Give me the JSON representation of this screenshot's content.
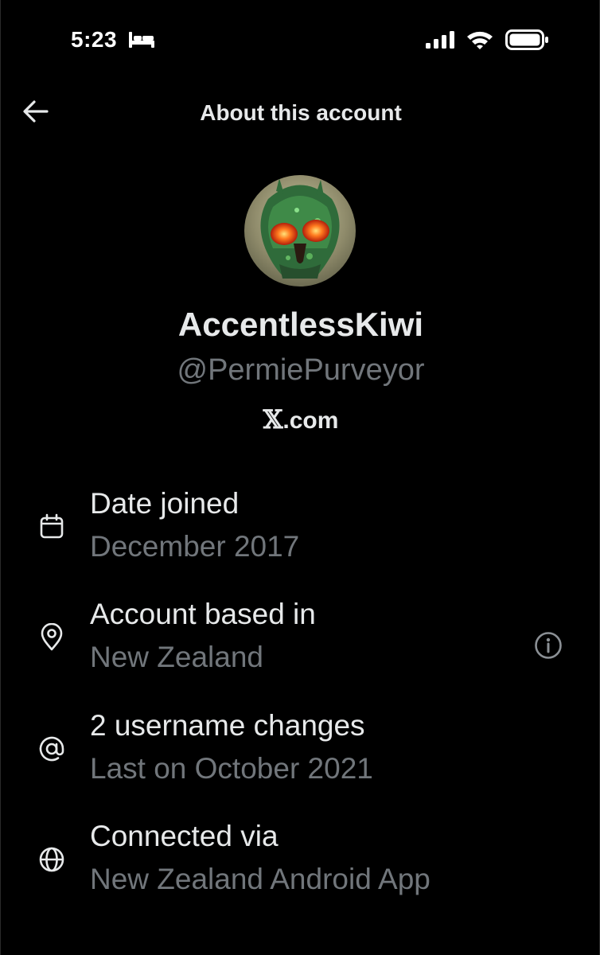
{
  "status_bar": {
    "time": "5:23",
    "icons": [
      "bed-icon",
      "signal-icon",
      "wifi-icon",
      "battery-icon"
    ]
  },
  "header": {
    "title": "About this account",
    "back_icon": "back-arrow-icon"
  },
  "profile": {
    "display_name": "AccentlessKiwi",
    "handle": "@PermiePurveyor",
    "platform_prefix": "𝕏",
    "platform_suffix": ".com"
  },
  "info_rows": [
    {
      "icon": "calendar-icon",
      "label": "Date joined",
      "value": "December 2017"
    },
    {
      "icon": "location-pin-icon",
      "label": "Account based in",
      "value": "New Zealand",
      "has_info_button": true
    },
    {
      "icon": "at-sign-icon",
      "label": "2 username changes",
      "value": "Last on October 2021"
    },
    {
      "icon": "globe-icon",
      "label": "Connected via",
      "value": "New Zealand Android App"
    }
  ],
  "colors": {
    "background": "#000000",
    "primary_text": "#e7e9ea",
    "secondary_text": "#71767b"
  }
}
